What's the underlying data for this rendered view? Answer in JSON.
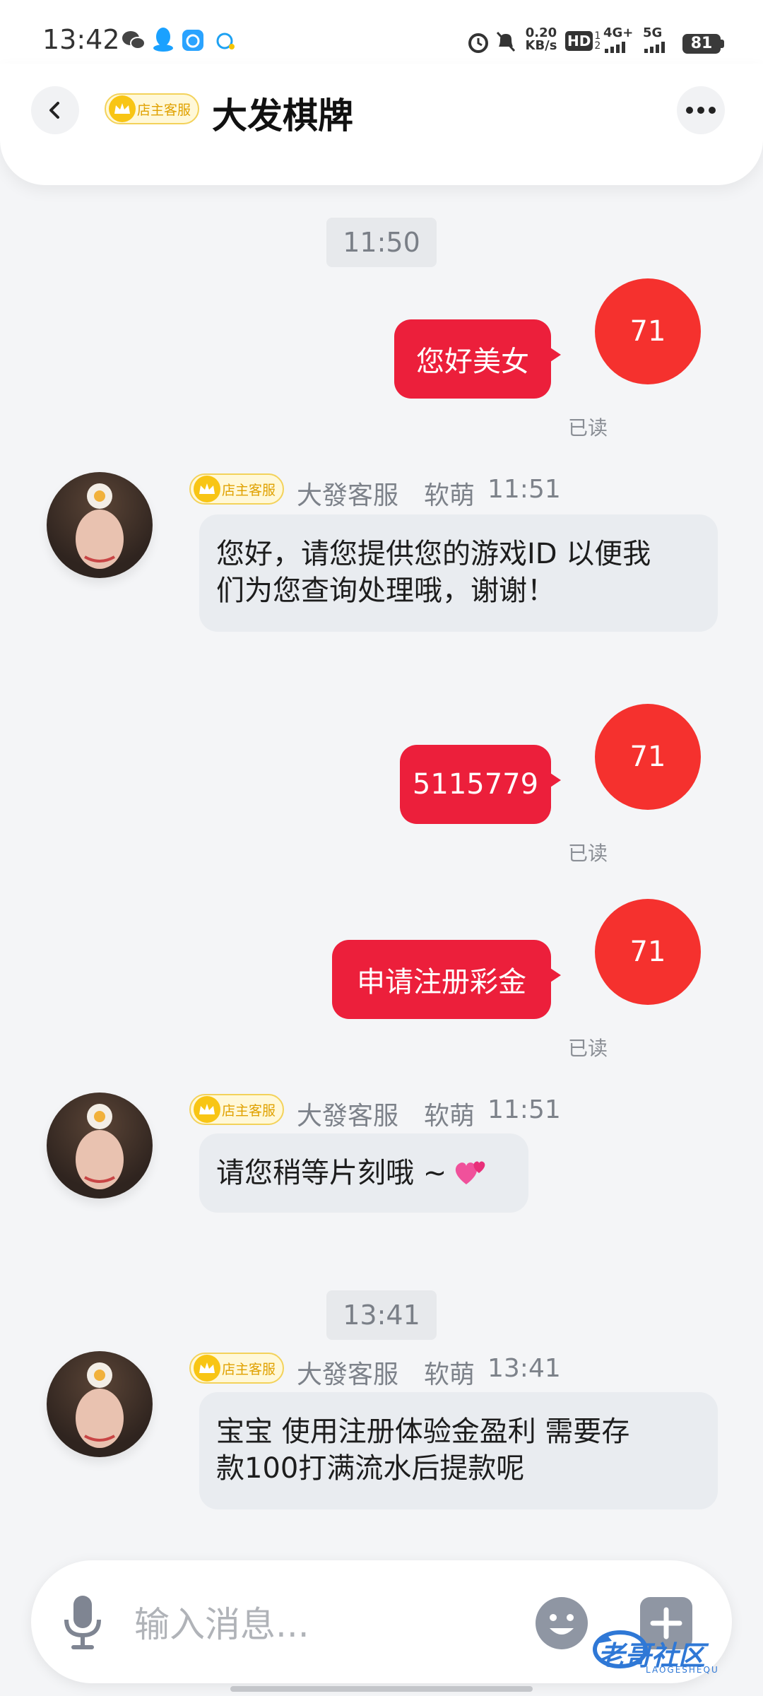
{
  "status_bar": {
    "time": "13:42",
    "app_icons": [
      "wechat-icon",
      "qq-icon",
      "tim-icon",
      "chat-bubble-icon"
    ],
    "net_speed_value": "0.20",
    "net_speed_unit": "KB/s",
    "hd": "HD",
    "hd_sub_1": "1",
    "hd_sub_2": "2",
    "net1": "4G+",
    "net2": "5G",
    "battery": "81"
  },
  "header": {
    "title": "大发棋牌",
    "badge": "店主客服"
  },
  "messages": [
    {
      "type": "time",
      "text": "11:50"
    },
    {
      "type": "me",
      "avatar": "71",
      "text": "您好美女",
      "read": "已读"
    },
    {
      "type": "agent",
      "badge": "店主客服",
      "name": "大發客服",
      "nick": "软萌",
      "time": "11:51",
      "line1": "您好，请您提供您的游戏ID 以便我",
      "line2": "们为您查询处理哦，谢谢！"
    },
    {
      "type": "me",
      "avatar": "71",
      "text": "5115779",
      "read": "已读"
    },
    {
      "type": "me",
      "avatar": "71",
      "text": "申请注册彩金",
      "read": "已读"
    },
    {
      "type": "agent",
      "badge": "店主客服",
      "name": "大發客服",
      "nick": "软萌",
      "time": "11:51",
      "line1": "请您稍等片刻哦 ~",
      "emoji": "two-hearts-icon"
    },
    {
      "type": "time",
      "text": "13:41"
    },
    {
      "type": "agent",
      "badge": "店主客服",
      "name": "大發客服",
      "nick": "软萌",
      "time": "13:41",
      "line1": "宝宝 使用注册体验金盈利 需要存",
      "line2": "款100打满流水后提款呢"
    }
  ],
  "input": {
    "placeholder": "输入消息..."
  },
  "watermark": {
    "main": "老哥社区",
    "sub": "LAOGESHEQU"
  },
  "colors": {
    "my_bubble": "#ec1f3b",
    "my_avatar": "#f5312e",
    "agent_bubble": "#e9ecf0",
    "badge": "#f8c514"
  }
}
